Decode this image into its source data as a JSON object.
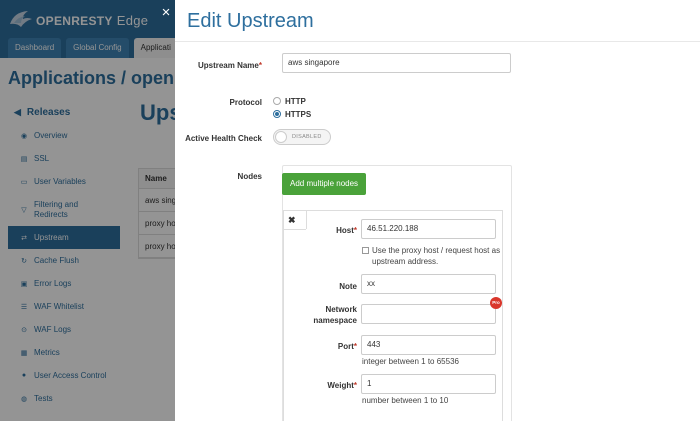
{
  "app": {
    "brand_main": "OPENRESTY",
    "brand_sub": "Edge",
    "nav_tabs": [
      "Dashboard",
      "Global Config",
      "Applicati"
    ],
    "page_heading": "Applications  /  openre",
    "main_title": "Ups",
    "sidebar": {
      "section_title": "Releases",
      "items": [
        {
          "label": "Overview",
          "icon": "eye-icon"
        },
        {
          "label": "SSL",
          "icon": "ssl-icon"
        },
        {
          "label": "User Variables",
          "icon": "variables-icon"
        },
        {
          "label": "Filtering and Redirects",
          "icon": "filter-icon"
        },
        {
          "label": "Upstream",
          "icon": "upstream-icon",
          "active": true
        },
        {
          "label": "Cache Flush",
          "icon": "cache-icon"
        },
        {
          "label": "Error Logs",
          "icon": "error-icon"
        },
        {
          "label": "WAF Whitelist",
          "icon": "whitelist-icon"
        },
        {
          "label": "WAF Logs",
          "icon": "waf-logs-icon"
        },
        {
          "label": "Metrics",
          "icon": "metrics-icon"
        },
        {
          "label": "User Access Control",
          "icon": "user-icon"
        },
        {
          "label": "Tests",
          "icon": "tests-icon"
        }
      ]
    },
    "table": {
      "header": "Name",
      "rows": [
        "aws singa",
        "proxy host",
        "proxy ho"
      ]
    }
  },
  "modal": {
    "title": "Edit Upstream",
    "close_symbol": "×",
    "upstream_name_label": "Upstream Name",
    "upstream_name_value": "aws singapore",
    "protocol_label": "Protocol",
    "protocol_options": [
      {
        "label": "HTTP",
        "checked": false
      },
      {
        "label": "HTTPS",
        "checked": true
      }
    ],
    "health_label": "Active Health Check",
    "health_toggle": "DISABLED",
    "nodes_label": "Nodes",
    "add_nodes_button": "Add multiple nodes",
    "node": {
      "remove_symbol": "✖",
      "host_label": "Host",
      "host_value": "46.51.220.188",
      "proxy_host_checkbox": "Use the proxy host / request host as upstream address.",
      "note_label": "Note",
      "note_value": "xx",
      "netns_label": "Network namespace",
      "netns_value": "",
      "pro_badge": "Pro",
      "port_label": "Port",
      "port_value": "443",
      "port_hint": "integer between 1 to 65536",
      "weight_label": "Weight",
      "weight_value": "1",
      "weight_hint": "number between 1 to 10"
    }
  },
  "colors": {
    "brand_blue": "#2e6f9e",
    "add_button_green": "#4aa23a",
    "required_red": "#c0392b",
    "pro_badge_red": "#d9362b"
  }
}
